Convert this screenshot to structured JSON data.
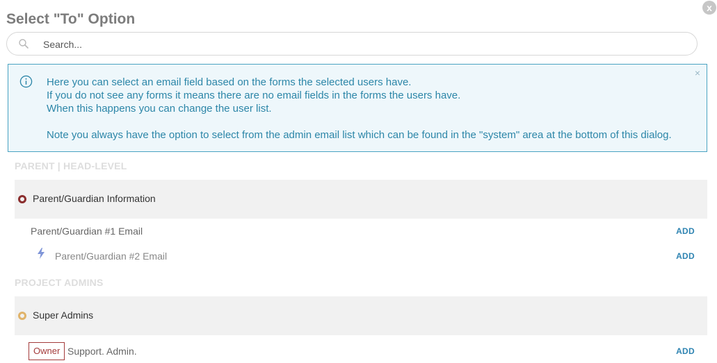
{
  "dialog": {
    "title": "Select \"To\" Option",
    "close_icon": "x"
  },
  "search": {
    "placeholder": "Search..."
  },
  "info": {
    "lines": [
      "Here you can select an email field based on the forms the selected users have.",
      "If you do not see any forms it means there are no email fields in the forms the users have.",
      "When this happens you can change the user list."
    ],
    "note": "Note you always have the option to select from the admin email list which can be found in the \"system\" area at the bottom of this dialog.",
    "dismiss": "×"
  },
  "sections": {
    "parent": {
      "header": "PARENT | HEAD-LEVEL",
      "group": "Parent/Guardian Information",
      "items": [
        {
          "label": "Parent/Guardian #1 Email",
          "action": "ADD"
        },
        {
          "label": "Parent/Guardian #2 Email",
          "action": "ADD"
        }
      ]
    },
    "admins": {
      "header": "PROJECT ADMINS",
      "group": "Super Admins",
      "items": [
        {
          "badge": "Owner",
          "label": "Support. Admin.",
          "action": "ADD"
        }
      ]
    }
  },
  "colors": {
    "accent": "#2f84b2",
    "info_text": "#2c86a8",
    "info_border": "#4aa3c2",
    "radio_selected": "#8b2e2e",
    "radio_gold": "#e0b36a"
  }
}
